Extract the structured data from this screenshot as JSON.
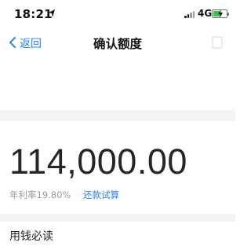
{
  "status_bar": {
    "time": "18:21",
    "network": "4G",
    "signal_bars_active": 2,
    "battery_color": "#35c44a"
  },
  "nav": {
    "back_label": "返回",
    "title": "确认额度"
  },
  "quota": {
    "amount": "114,000.00",
    "annual_rate": "年利率19.80%",
    "repay_calc_link": "还款试算"
  },
  "section": {
    "must_read_title": "用钱必读"
  },
  "colors": {
    "accent": "#2f80ed",
    "muted_text": "#9a9a9a",
    "separator_bg": "#f3f4f6"
  }
}
